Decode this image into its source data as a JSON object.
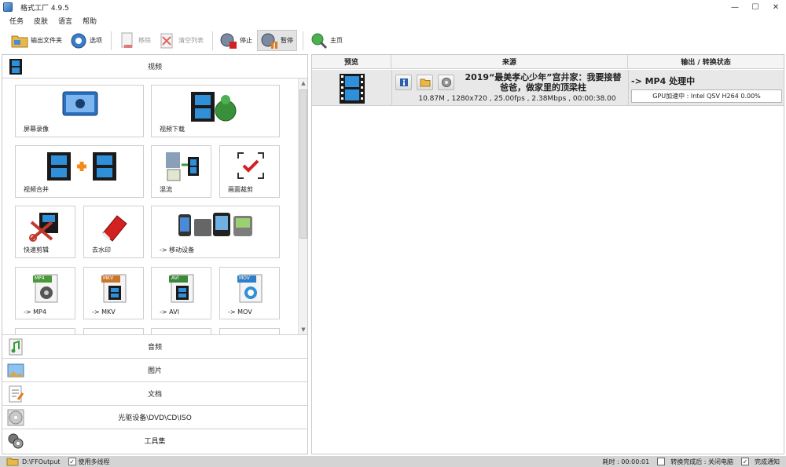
{
  "window": {
    "title": "格式工厂 4.9.5",
    "min": "—",
    "max": "☐",
    "close": "✕"
  },
  "menu": [
    "任务",
    "皮肤",
    "语言",
    "帮助"
  ],
  "toolbar": {
    "output_folder": "输出文件夹",
    "options": "选项",
    "remove": "移除",
    "clear_list": "清空列表",
    "stop": "停止",
    "pause": "暂停",
    "home": "主页"
  },
  "left": {
    "video_header": "视频",
    "tiles": [
      "屏幕录像",
      "视频下载",
      "视频合并",
      "混流",
      "画面裁剪",
      "快速剪辑",
      "去水印",
      "-> 移动设备",
      "-> MP4",
      "-> MKV",
      "-> AVI",
      "-> MOV"
    ],
    "format_badges": [
      "MP4",
      "MKV",
      "AVI",
      "MOV"
    ],
    "categories": [
      "音频",
      "图片",
      "文档",
      "光驱设备\\DVD\\CD\\ISO",
      "工具集"
    ]
  },
  "right": {
    "headers": {
      "preview": "预览",
      "source": "来源",
      "status": "输出 / 转换状态"
    },
    "task": {
      "title": "2019“最美孝心少年”宫井家：我要接替爸爸，做家里的顶梁柱",
      "info": "10.87M , 1280x720 , 25.00fps , 2.38Mbps , 00:00:38.00",
      "status": "-> MP4 处理中",
      "gpu": "GPU加速中 : Intel QSV H264 0.00%",
      "progress": 0.0
    }
  },
  "statusbar": {
    "output_path": "D:\\FFOutput",
    "multithread": "使用多线程",
    "elapsed": "耗时 : 00:00:01",
    "after_convert": "转换完成后 : 关闭电脑",
    "notify": "完成通知"
  },
  "colors": {
    "accent_pause": "#e3e3e3",
    "statusbar": "#d4d4d4",
    "row_bg": "#e8e8e8"
  }
}
